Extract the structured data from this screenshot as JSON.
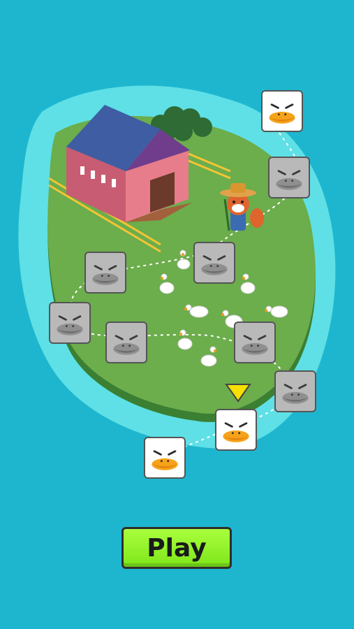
{
  "play_button": {
    "label": "Play"
  },
  "current_level": 2,
  "levels": [
    {
      "id": 1,
      "state": "unlocked"
    },
    {
      "id": 2,
      "state": "unlocked"
    },
    {
      "id": 3,
      "state": "locked"
    },
    {
      "id": 4,
      "state": "locked"
    },
    {
      "id": 5,
      "state": "locked"
    },
    {
      "id": 6,
      "state": "locked"
    },
    {
      "id": 7,
      "state": "locked"
    },
    {
      "id": 8,
      "state": "locked"
    },
    {
      "id": 9,
      "state": "locked"
    },
    {
      "id": 10,
      "state": "unlocked"
    }
  ],
  "colors": {
    "sea": "#1eb6cf",
    "shallow": "#5ee0e6",
    "island": "#6cad4c",
    "barn_wall": "#e77d8a",
    "barn_roof": "#3f5da3",
    "play_button": "#8cf02a",
    "marker": "#f5e000"
  },
  "icons": [
    "goose-face-icon",
    "locked-goose-face-icon",
    "current-level-marker-icon"
  ]
}
